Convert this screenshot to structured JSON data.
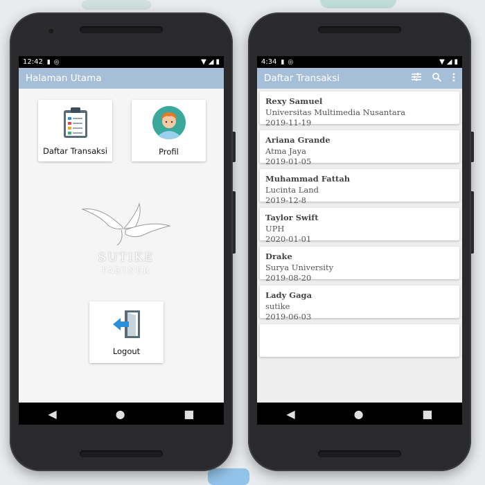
{
  "left_phone": {
    "status_time": "12:42",
    "app_title": "Halaman Utama",
    "menu": {
      "transactions_label": "Daftar Transaksi",
      "profile_label": "Profil",
      "logout_label": "Logout"
    },
    "logo": {
      "line1": "SUTIKE",
      "line2": "PARTNER"
    }
  },
  "right_phone": {
    "status_time": "4:34",
    "app_title": "Daftar Transaksi",
    "icons": [
      "filter-icon",
      "search-icon",
      "more-vert-icon"
    ],
    "transactions": [
      {
        "name": "Rexy Samuel",
        "place": "Universitas Multimedia Nusantara",
        "date": "2019-11-19"
      },
      {
        "name": "Ariana Grande",
        "place": "Atma Jaya",
        "date": "2019-01-05"
      },
      {
        "name": "Muhammad Fattah",
        "place": "Lucinta Land",
        "date": "2019-12-8"
      },
      {
        "name": "Taylor Swift",
        "place": "UPH",
        "date": "2020-01-01"
      },
      {
        "name": "Drake",
        "place": "Surya University",
        "date": "2019-08-20"
      },
      {
        "name": "Lady Gaga",
        "place": "sutike",
        "date": "2019-06-03"
      }
    ]
  },
  "colors": {
    "appbar": "#a7bed8",
    "statusbar": "#000000",
    "accent_blue": "#2d8fd8"
  }
}
